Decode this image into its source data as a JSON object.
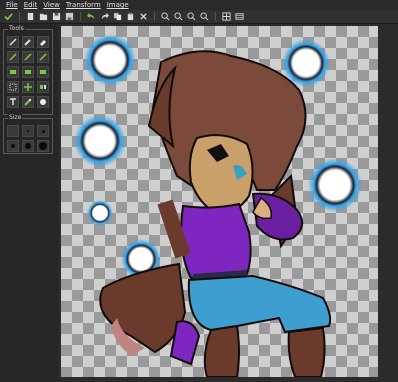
{
  "menu": {
    "file": "File",
    "edit": "Edit",
    "view": "View",
    "transform": "Transform",
    "image": "Image"
  },
  "toolbar": {
    "icons": [
      "check-icon",
      "new-file-icon",
      "open-icon",
      "save-icon",
      "save-as-icon",
      "undo-icon",
      "redo-icon",
      "copy-icon",
      "paste-icon",
      "delete-icon",
      "zoom-out-icon",
      "zoom-in-icon",
      "zoom-fit-icon",
      "zoom-actual-icon",
      "grid-icon",
      "canvas-size-icon"
    ]
  },
  "tools_panel": {
    "title": "Tools",
    "tools": [
      {
        "icon": "pencil-icon"
      },
      {
        "icon": "brush-icon"
      },
      {
        "icon": "eraser-icon"
      },
      {
        "icon": "line-icon"
      },
      {
        "icon": "fill-icon"
      },
      {
        "icon": "spray-icon"
      },
      {
        "icon": "rect-icon"
      },
      {
        "icon": "filled-rect-icon"
      },
      {
        "icon": "ellipse-icon"
      },
      {
        "icon": "select-icon"
      },
      {
        "icon": "move-icon"
      },
      {
        "icon": "flip-icon"
      },
      {
        "icon": "text-icon"
      },
      {
        "icon": "picker-icon"
      },
      {
        "icon": "stamp-icon"
      }
    ]
  },
  "size_panel": {
    "title": "Size",
    "sizes": [
      1,
      2,
      3,
      4,
      6,
      8
    ]
  },
  "colors": {
    "accent_green": "#7ec843",
    "panel": "#262626",
    "canvas_light": "#cfcfcf",
    "canvas_dark": "#9a9a9a"
  }
}
